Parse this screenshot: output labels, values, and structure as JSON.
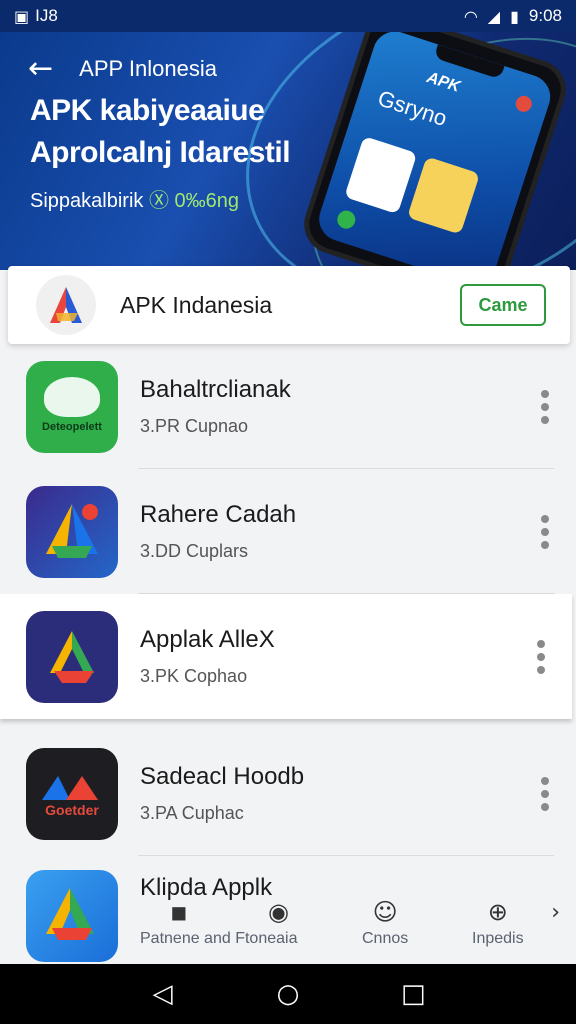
{
  "status_bar": {
    "time": "9:08",
    "left_text": "IJ8"
  },
  "header": {
    "back_title": "APP Inlonesia",
    "hero_line1": "APK kabiyeaaiue",
    "hero_line2": "Aprolcalnj Idarestil",
    "hero_sub_prefix": "Sippakalbirik ",
    "hero_sub_accent": "Ⓧ 0‰6ng",
    "phone_brand": "APK",
    "phone_title": "Gsryno"
  },
  "pinned": {
    "name": "APK Indanesia",
    "button_label": "Came"
  },
  "apps": [
    {
      "title": "Bahaltrclianak",
      "subtitle": "3.PR Cupnao",
      "icon_text": "Deteopelett",
      "icon_name": "green-app-icon"
    },
    {
      "title": "Rahere Cadah",
      "subtitle": "3.DD Cuplars",
      "icon_name": "maps-app-icon"
    },
    {
      "title": "Applak AlleX",
      "subtitle": "3.PK Cophao",
      "icon_name": "drive-app-icon"
    },
    {
      "title": "Sadeacl Hoodb",
      "subtitle": "3.PA Cuphac",
      "icon_text": "Goetder",
      "icon_name": "dark-app-icon"
    },
    {
      "title": "Klipda Applk",
      "subtitle": "",
      "icon_name": "blue-drive-app-icon"
    }
  ],
  "tabs": [
    {
      "label": "Patnene and Ftoneaia",
      "icon": "◾"
    },
    {
      "label": "Cnnos",
      "icon": "☺"
    },
    {
      "label": "Inpedis",
      "icon": "⊕"
    }
  ],
  "colors": {
    "accent_green": "#2e9a3e",
    "header_blue": "#1a4fb0"
  }
}
